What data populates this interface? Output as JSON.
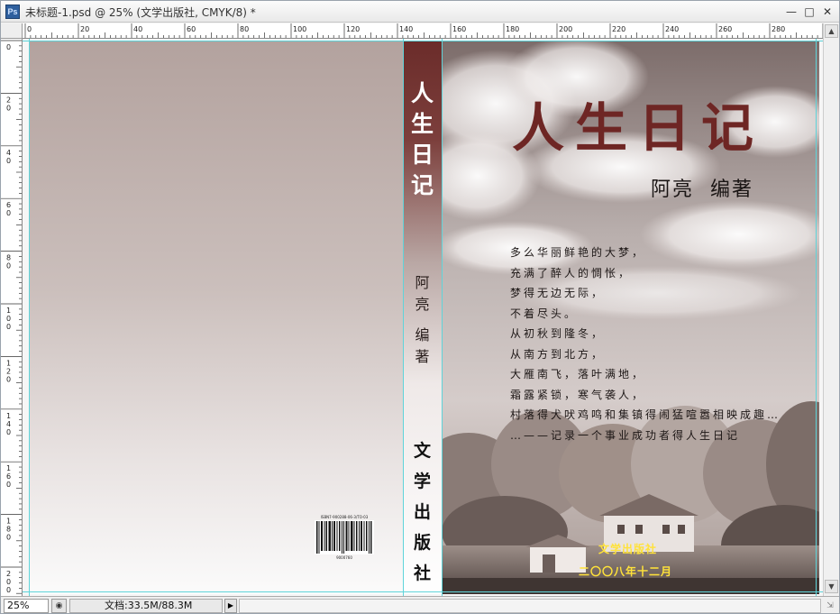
{
  "window": {
    "title": "未标题-1.psd @ 25% (文学出版社, CMYK/8) *",
    "app_icon_label": "Ps",
    "minimize_icon": "minimize-icon",
    "restore_icon": "restore-icon",
    "close_icon": "close-icon"
  },
  "ruler": {
    "horizontal_labels": [
      "0",
      "20",
      "40",
      "60",
      "80",
      "100",
      "120",
      "140",
      "160",
      "180",
      "200",
      "220",
      "240",
      "260",
      "280"
    ],
    "vertical_labels": [
      "0",
      "20",
      "40",
      "60",
      "80",
      "100",
      "120",
      "140",
      "160",
      "180",
      "200"
    ]
  },
  "spine": {
    "title_chars": [
      "人",
      "生",
      "日",
      "记"
    ],
    "author_chars": [
      "阿",
      "亮",
      "编",
      "著"
    ],
    "publisher_chars": [
      "文",
      "学",
      "出",
      "版",
      "社"
    ]
  },
  "back_cover": {
    "isbn_text": "ISBN7-900288-06-3/TO·03",
    "barcode_number": "9000760"
  },
  "front_cover": {
    "title": "人生日记",
    "author": "阿亮  编著",
    "poem_lines": [
      "多么华丽鲜艳的大梦，",
      "充满了醉人的惆怅，",
      "梦得无边无际，",
      "不着尽头。",
      "从初秋到隆冬，",
      "从南方到北方，",
      "大雁南飞，落叶满地，",
      "霜露紧锁，寒气袭人，",
      "村落得犬吠鸡鸣和集镇得闹猛喧嚣相映成趣…",
      "…——记录一个事业成功者得人生日记"
    ],
    "publisher": "文学出版社",
    "date": "二〇〇八年十二月"
  },
  "status": {
    "zoom": "25%",
    "doc_size": "文档:33.5M/88.3M"
  },
  "colors": {
    "title_red": "#6e2624",
    "spine_dark": "#6b2c2a",
    "guide_cyan": "#5fd4da",
    "publisher_yellow": "#ffe23a"
  }
}
